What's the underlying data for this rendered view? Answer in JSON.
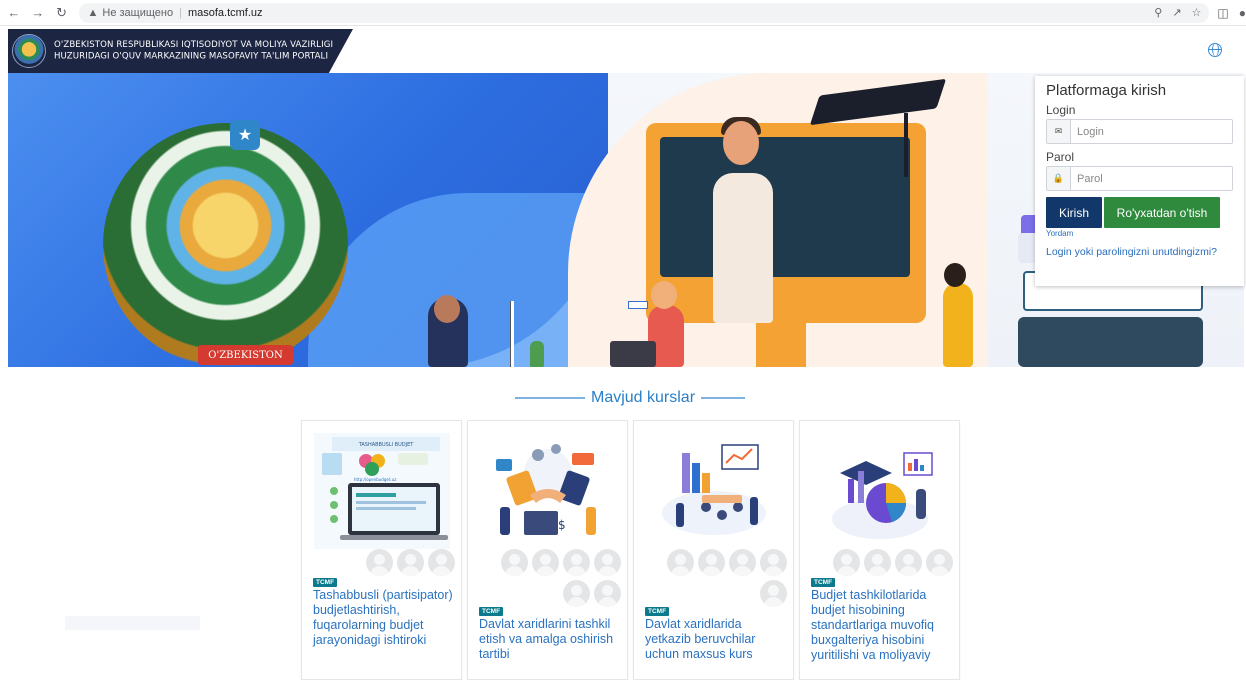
{
  "browser": {
    "security_label": "Не защищено",
    "url": "masofa.tcmf.uz"
  },
  "header": {
    "brand_line1": "O'ZBEKISTON RESPUBLIKASI IQTISODIYOT VA MOLIYA VAZIRLIGI",
    "brand_line2": "HUZURIDAGI O'QUV MARKAZINING MASOFAVIY TA'LIM PORTALI"
  },
  "hero": {
    "ribbon_text": "O'ZBEKISTON"
  },
  "login": {
    "title": "Platformaga kirish",
    "login_label": "Login",
    "login_placeholder": "Login",
    "password_label": "Parol",
    "password_placeholder": "Parol",
    "submit_label": "Kirish",
    "register_label": "Ro'yxatdan o'tish",
    "help_label": "Yordam",
    "forgot_label": "Login yoki parolingizni unutdingizmi?"
  },
  "courses": {
    "section_title": "Mavjud kurslar",
    "items": [
      {
        "badge": "TCMF",
        "title": "Tashabbusli (partisipator) budjetlashtirish, fuqarolarning budjet jarayonidagi ishtiroki",
        "avatars": 3,
        "image_heading": "TASHABBUSLI BUDJET",
        "image_url_text": "http://openbudget.uz"
      },
      {
        "badge": "TCMF",
        "title": "Davlat xaridlarini tashkil etish va amalga oshirish tartibi",
        "avatars": 6
      },
      {
        "badge": "TCMF",
        "title": "Davlat xaridlarida yetkazib beruvchilar uchun maxsus kurs",
        "avatars": 5
      },
      {
        "badge": "TCMF",
        "title": "Budjet tashkilotlarida budjet hisobining standartlariga muvofiq buxgalteriya hisobini yuritilishi va moliyaviy",
        "avatars": 4
      }
    ]
  },
  "colors": {
    "brand_navy": "#1c2541",
    "primary_button": "#12386b",
    "success_button": "#2f8a3d",
    "link": "#2a72c0",
    "badge": "#0b7a8c"
  }
}
